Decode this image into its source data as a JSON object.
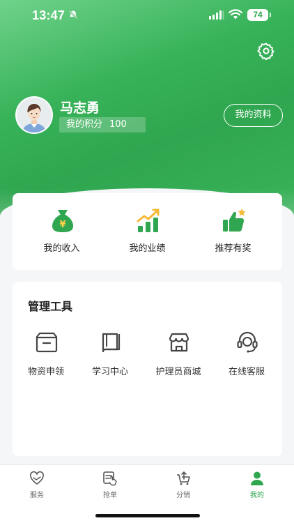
{
  "status": {
    "time": "13:47",
    "battery": "74"
  },
  "user": {
    "name": "马志勇",
    "points_label": "我的积分",
    "points_value": "100",
    "profile_button": "我的资料"
  },
  "quick_actions": [
    {
      "label": "我的收入",
      "icon": "money-bag-icon"
    },
    {
      "label": "我的业绩",
      "icon": "bar-chart-icon"
    },
    {
      "label": "推荐有奖",
      "icon": "thumbs-up-icon"
    }
  ],
  "tools": {
    "title": "管理工具",
    "items": [
      {
        "label": "物资申领",
        "icon": "box-icon"
      },
      {
        "label": "学习中心",
        "icon": "book-icon"
      },
      {
        "label": "护理员商城",
        "icon": "store-icon"
      },
      {
        "label": "在线客服",
        "icon": "headset-icon"
      }
    ]
  },
  "tabs": [
    {
      "label": "服务",
      "icon": "heart-hand-icon"
    },
    {
      "label": "抢单",
      "icon": "grab-order-icon"
    },
    {
      "label": "分销",
      "icon": "cart-share-icon"
    },
    {
      "label": "我的",
      "icon": "person-icon",
      "active": true
    }
  ],
  "colors": {
    "accent": "#2fa64f",
    "chart_orange": "#f5b935"
  }
}
